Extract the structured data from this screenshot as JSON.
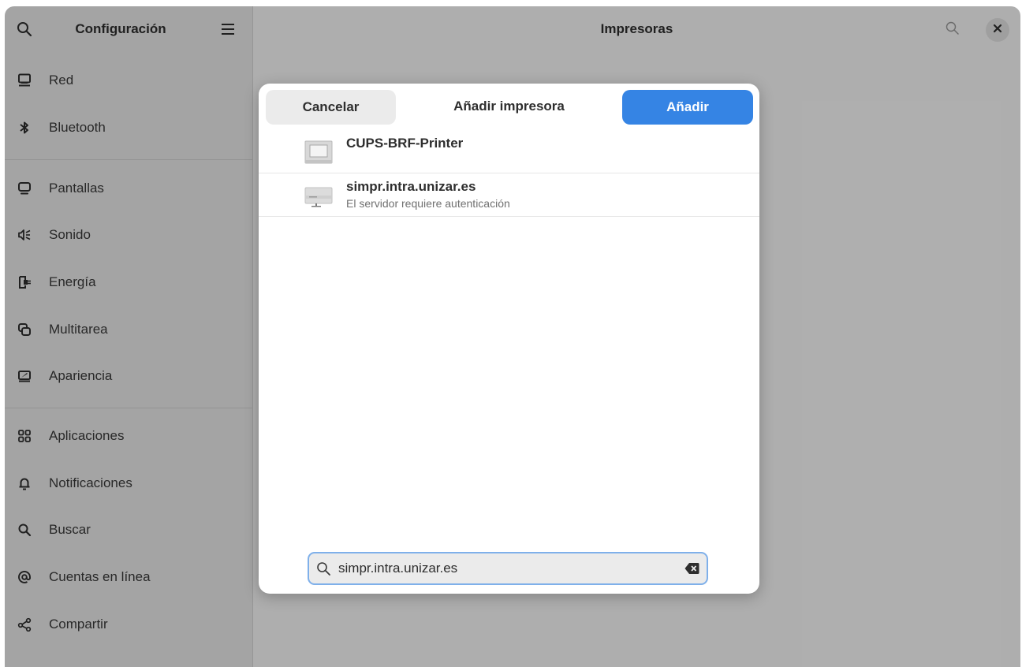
{
  "sidebar": {
    "title": "Configuración",
    "items": [
      {
        "label": "Red",
        "icon": "network-wired-icon"
      },
      {
        "label": "Bluetooth",
        "icon": "bluetooth-icon"
      },
      {
        "label": "Pantallas",
        "icon": "display-icon"
      },
      {
        "label": "Sonido",
        "icon": "speaker-icon"
      },
      {
        "label": "Energía",
        "icon": "power-plug-icon"
      },
      {
        "label": "Multitarea",
        "icon": "multitasking-icon"
      },
      {
        "label": "Apariencia",
        "icon": "appearance-icon"
      },
      {
        "label": "Aplicaciones",
        "icon": "apps-grid-icon"
      },
      {
        "label": "Notificaciones",
        "icon": "bell-icon"
      },
      {
        "label": "Buscar",
        "icon": "search-icon"
      },
      {
        "label": "Cuentas en línea",
        "icon": "at-sign-icon"
      },
      {
        "label": "Compartir",
        "icon": "share-icon"
      }
    ]
  },
  "main": {
    "title": "Impresoras"
  },
  "dialog": {
    "title": "Añadir impresora",
    "cancel_label": "Cancelar",
    "add_label": "Añadir",
    "printers": [
      {
        "name": "CUPS-BRF-Printer",
        "status": ""
      },
      {
        "name": "simpr.intra.unizar.es",
        "status": "El servidor requiere autenticación"
      }
    ],
    "search_value": "simpr.intra.unizar.es"
  },
  "colors": {
    "accent": "#3584e4",
    "sidebar_bg": "#ebebeb",
    "window_bg": "#fafafa"
  }
}
